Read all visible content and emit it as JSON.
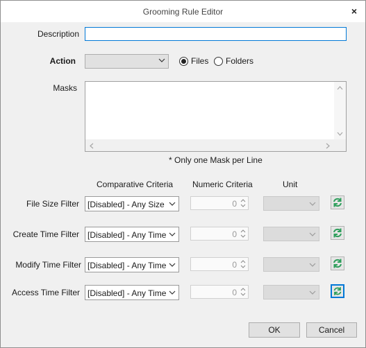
{
  "window": {
    "title": "Grooming Rule Editor",
    "close_glyph": "×"
  },
  "description": {
    "label": "Description",
    "value": ""
  },
  "action": {
    "label": "Action",
    "selected": "",
    "options": [
      "Files",
      "Folders"
    ],
    "checked": "Files"
  },
  "masks": {
    "label": "Masks",
    "value": "",
    "note": "* Only one Mask per Line"
  },
  "filters": {
    "headers": {
      "comparative": "Comparative Criteria",
      "numeric": "Numeric Criteria",
      "unit": "Unit"
    },
    "rows": [
      {
        "label": "File Size Filter",
        "criteria": "[Disabled] - Any Size",
        "numeric": "0",
        "unit": "",
        "icon": "refresh-icon"
      },
      {
        "label": "Create Time Filter",
        "criteria": "[Disabled] - Any Time",
        "numeric": "0",
        "unit": "",
        "icon": "refresh-icon"
      },
      {
        "label": "Modify Time Filter",
        "criteria": "[Disabled] - Any Time",
        "numeric": "0",
        "unit": "",
        "icon": "refresh-icon"
      },
      {
        "label": "Access Time Filter",
        "criteria": "[Disabled] - Any Time",
        "numeric": "0",
        "unit": "",
        "icon": "refresh-icon"
      }
    ]
  },
  "buttons": {
    "ok": "OK",
    "cancel": "Cancel"
  },
  "colors": {
    "accent": "#0078d7",
    "icon_green": "#2e9e5b"
  }
}
